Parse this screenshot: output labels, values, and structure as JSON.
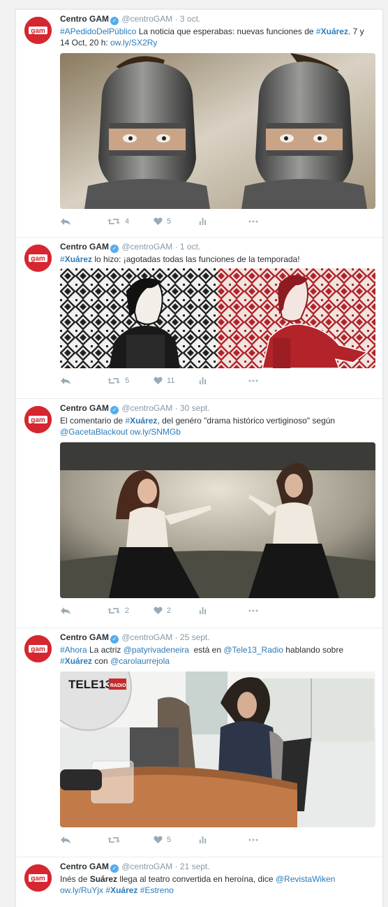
{
  "colors": {
    "brand": "#d6262f",
    "link": "#2b7bb9",
    "muted": "#8899a6",
    "verified": "#55acee"
  },
  "tweets": [
    {
      "author": "Centro GAM",
      "handle": "@centroGAM",
      "separator": "·",
      "date": "3 oct.",
      "t1": "#APedidoDelPúblico",
      "t2": " La noticia que esperabas: nuevas funciones de ",
      "t3": "#",
      "t4": "Xuárez",
      "t5": ". 7 y 14 Oct, 20 h: ",
      "t6": "ow.ly/SX2Ry",
      "retweets": "4",
      "likes": "5"
    },
    {
      "author": "Centro GAM",
      "handle": "@centroGAM",
      "separator": "·",
      "date": "1 oct.",
      "t1": "#",
      "t2": "Xuárez",
      "t3": " lo hizo: ¡agotadas todas las funciones de la temporada!",
      "retweets": "5",
      "likes": "11"
    },
    {
      "author": "Centro GAM",
      "handle": "@centroGAM",
      "separator": "·",
      "date": "30 sept.",
      "t1": "El comentario de ",
      "t2": "#",
      "t3": "Xuárez",
      "t4": ", del genéro \"drama histórico vertiginoso\" según ",
      "t5": "@GacetaBlackout",
      "t6": " ",
      "t7": "ow.ly/SNMGb",
      "retweets": "2",
      "likes": "2"
    },
    {
      "author": "Centro GAM",
      "handle": "@centroGAM",
      "separator": "·",
      "date": "25 sept.",
      "t1": "#Ahora",
      "t2": " La actriz ",
      "t3": "@patyrivadeneira",
      "t4": "  está en ",
      "t5": "@Tele13_Radio",
      "t6": " hablando sobre ",
      "t7": "#",
      "t8": "Xuárez",
      "t9": " con ",
      "t10": "@carolaurrejola",
      "image_sign": "TELE13",
      "image_sign_sub": "RADIO",
      "retweets": "",
      "likes": "5"
    },
    {
      "author": "Centro GAM",
      "handle": "@centroGAM",
      "separator": "·",
      "date": "21 sept.",
      "t1": "Inés de ",
      "t2": "Suárez",
      "t3": " llega al teatro convertida en heroína, dice ",
      "t4": "@RevistaWiken",
      "t5": "ow.ly/RuYjx",
      "t6": " ",
      "t7": "#",
      "t8": "Xuárez",
      "t9": " ",
      "t10": "#Estreno"
    }
  ]
}
